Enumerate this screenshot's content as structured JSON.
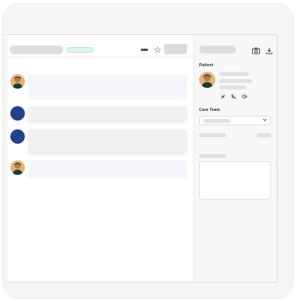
{
  "toolbar": {
    "more_icon": "•••",
    "star_icon": "☆"
  },
  "messages": [
    {
      "avatar": "person-photo",
      "bubble": "light"
    },
    {
      "avatar": "navy-circle",
      "bubble": "grey"
    },
    {
      "avatar": "navy-circle",
      "bubble": "grey"
    },
    {
      "avatar": "person-photo",
      "bubble": "light"
    }
  ],
  "sidebar": {
    "patient_label": "Patient",
    "care_team_label": "Care Team",
    "icons": {
      "camera": "camera-icon",
      "download": "download-icon",
      "edit": "edit-icon",
      "phone": "phone-icon",
      "video": "video-icon",
      "chevron": "chevron-down-icon"
    }
  },
  "colors": {
    "accent_badge": "#dff5ef",
    "avatar_navy": "#22418d",
    "avatar_skin": "#e8b274"
  }
}
